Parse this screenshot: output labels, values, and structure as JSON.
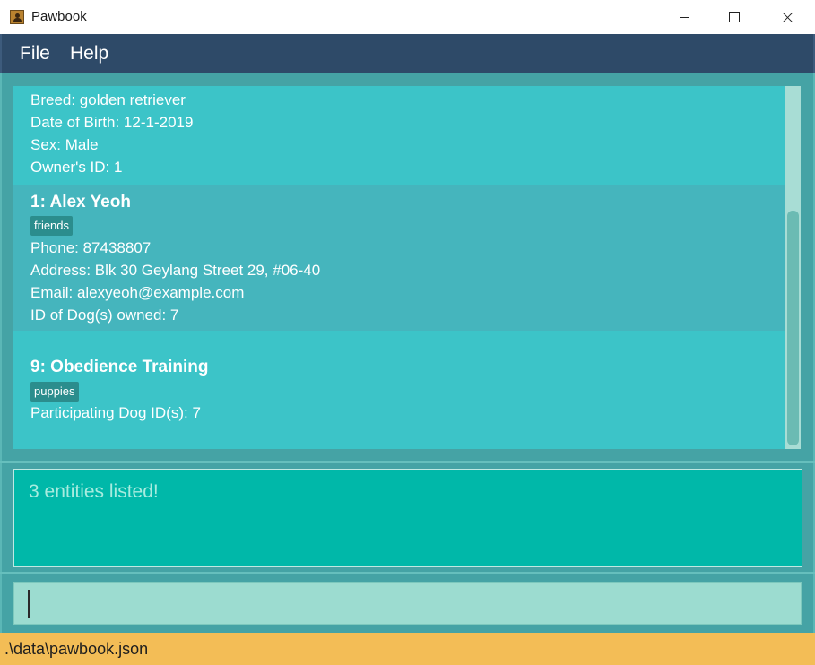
{
  "window": {
    "title": "Pawbook",
    "icon": "contact-book-icon"
  },
  "menu": {
    "file": "File",
    "help": "Help"
  },
  "list": {
    "dog": {
      "breed": "Breed: golden retriever",
      "dob": "Date of Birth: 12-1-2019",
      "sex": "Sex: Male",
      "owner_id": "Owner's ID: 1"
    },
    "owner": {
      "title": "1:  Alex Yeoh",
      "tag": "friends",
      "phone": "Phone: 87438807",
      "address": "Address: Blk 30 Geylang Street 29, #06-40",
      "email": "Email: alexyeoh@example.com",
      "dogs_owned": "ID of Dog(s) owned: 7"
    },
    "program": {
      "title": "9:  Obedience Training",
      "tag": "puppies",
      "participants": "Participating Dog ID(s): 7"
    }
  },
  "result": {
    "text": "3 entities listed!"
  },
  "command": {
    "value": ""
  },
  "status": {
    "path": ".\\data\\pawbook.json"
  },
  "colors": {
    "menubar": "#2e4a68",
    "card": "#3cc4c8",
    "card_selected": "#45b5bd",
    "tag": "#2b8d8d",
    "result_bg": "#00b8a9",
    "command_bg": "#9cdcd0",
    "statusbar": "#f3bd56"
  }
}
